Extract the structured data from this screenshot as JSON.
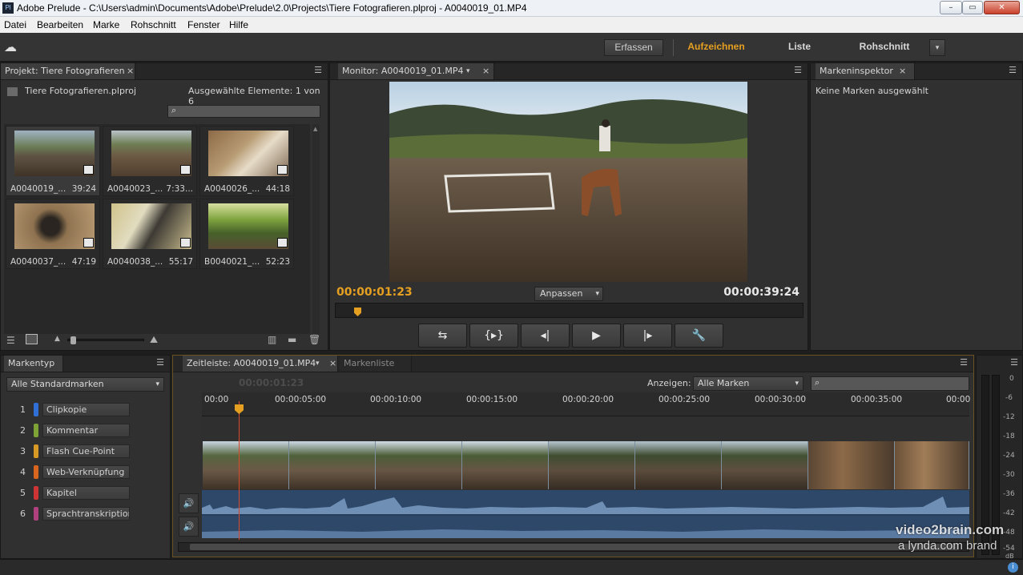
{
  "window": {
    "title": "Adobe Prelude - C:\\Users\\admin\\Documents\\Adobe\\Prelude\\2.0\\Projects\\Tiere Fotografieren.plproj - A0040019_01.MP4",
    "app_icon": "Pl"
  },
  "menubar": [
    "Datei",
    "Bearbeiten",
    "Marke",
    "Rohschnitt",
    "Fenster",
    "Hilfe"
  ],
  "workspaces": {
    "capture": "Erfassen",
    "record": "Aufzeichnen",
    "list": "Liste",
    "rough_cut": "Rohschnitt",
    "accent_color": "#e6a021"
  },
  "project": {
    "tab": "Projekt: Tiere Fotografieren",
    "file": "Tiere Fotografieren.plproj",
    "selected": "Ausgewählte Elemente: 1 von 6",
    "clips": [
      {
        "name": "A0040019_...",
        "dur": "39:24"
      },
      {
        "name": "A0040023_...",
        "dur": "7:33..."
      },
      {
        "name": "A0040026_...",
        "dur": "44:18"
      },
      {
        "name": "A0040037_...",
        "dur": "47:19"
      },
      {
        "name": "A0040038_...",
        "dur": "55:17"
      },
      {
        "name": "B0040021_...",
        "dur": "52:23"
      }
    ]
  },
  "monitor": {
    "tab": "Monitor: A0040019_01.MP4",
    "current": "00:00:01:23",
    "duration": "00:00:39:24",
    "fit": "Anpassen"
  },
  "inspector": {
    "tab": "Markeninspektor",
    "empty": "Keine Marken ausgewählt"
  },
  "marker_types": {
    "tab": "Markentyp",
    "filter": "Alle Standardmarken",
    "items": [
      {
        "num": "1",
        "label": "Clipkopie",
        "color": "#2f6fd6"
      },
      {
        "num": "2",
        "label": "Kommentar",
        "color": "#7fa236"
      },
      {
        "num": "3",
        "label": "Flash Cue-Point",
        "color": "#d89a24"
      },
      {
        "num": "4",
        "label": "Web-Verknüpfung",
        "color": "#d9661f"
      },
      {
        "num": "5",
        "label": "Kapitel",
        "color": "#cf3434"
      },
      {
        "num": "6",
        "label": "Sprachtranskription",
        "color": "#b0407e"
      }
    ]
  },
  "timeline": {
    "tab": "Zeitleiste: A0040019_01.MP4",
    "tab2": "Markenliste",
    "timecode_ghost": "00:00:01:23",
    "show_label": "Anzeigen:",
    "show_value": "Alle Marken",
    "ticks": [
      "00:00",
      "00:00:05:00",
      "00:00:10:00",
      "00:00:15:00",
      "00:00:20:00",
      "00:00:25:00",
      "00:00:30:00",
      "00:00:35:00",
      "00:00"
    ]
  },
  "meter": {
    "ticks": [
      "0",
      "-6",
      "-12",
      "-18",
      "-24",
      "-30",
      "-36",
      "-42",
      "-48",
      "-54",
      "dB"
    ]
  },
  "watermark": {
    "line1": "video2brain.com",
    "line2": "a lynda.com brand"
  }
}
